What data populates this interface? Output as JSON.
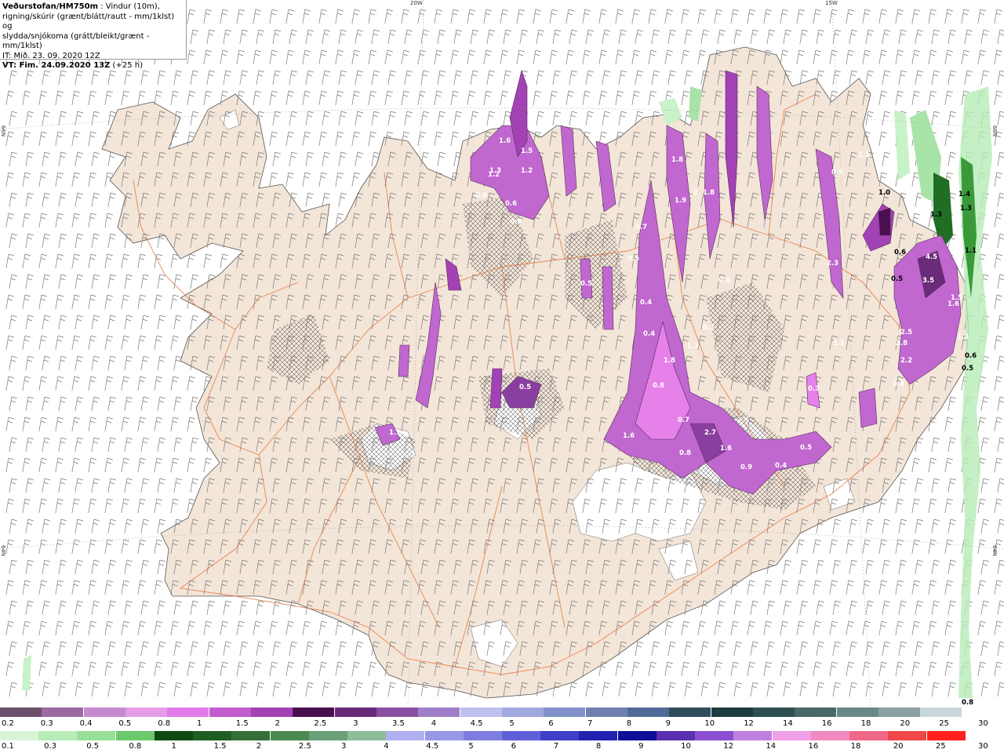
{
  "header": {
    "line1_bold": "Veðurstofan/HM750m",
    "line1_rest": " : Vindur (10m),",
    "line2": "rigning/skúrir (grænt/blátt/rautt - mm/1klst) og",
    "line3": "slydda/snjókoma (grátt/bleikt/grænt - mm/1klst)",
    "line4": "IT: Mið. 23. 09. 2020 12Z",
    "line5_bold": "VT: Fim. 24.09.2020 13Z",
    "line5_rest": " (+25 h)"
  },
  "grid_labels": {
    "lon_20w": "20W",
    "lon_15w": "15W",
    "lat_66n_left": "66N",
    "lat_66n_right": "66N",
    "lat_64n_left": "64N",
    "lat_64n_right": "64N"
  },
  "colors": {
    "land": "#f3e5d8",
    "sea": "#ffffff",
    "roads": "#e8743a",
    "coast": "#555555",
    "snow": "#9b59b6",
    "rain": "#5cd68a"
  },
  "map_labels": [
    {
      "id": "l1",
      "text": "1.6"
    },
    {
      "id": "l2",
      "text": "1.3"
    },
    {
      "id": "l3",
      "text": "1.2"
    },
    {
      "id": "l4",
      "text": "0.6"
    },
    {
      "id": "l5",
      "text": "1.5"
    },
    {
      "id": "l6",
      "text": "0.6"
    },
    {
      "id": "l7",
      "text": "1.2"
    },
    {
      "id": "l8",
      "text": "0.6"
    },
    {
      "id": "l9",
      "text": "1.8"
    },
    {
      "id": "l10",
      "text": "1.9"
    },
    {
      "id": "l11",
      "text": "2"
    },
    {
      "id": "l12",
      "text": "1.8"
    },
    {
      "id": "l13",
      "text": "0.7"
    },
    {
      "id": "l14",
      "text": "0.5"
    },
    {
      "id": "l15",
      "text": "0.4"
    },
    {
      "id": "l16",
      "text": "0.4"
    },
    {
      "id": "l17",
      "text": "1.8"
    },
    {
      "id": "l18",
      "text": "1.3"
    },
    {
      "id": "l19",
      "text": "0.7"
    },
    {
      "id": "l20",
      "text": "0.8"
    },
    {
      "id": "l21",
      "text": "0.7"
    },
    {
      "id": "l22",
      "text": "2.7"
    },
    {
      "id": "l23",
      "text": "1.6"
    },
    {
      "id": "l24",
      "text": "0.8"
    },
    {
      "id": "l25",
      "text": "1.6"
    },
    {
      "id": "l26",
      "text": "0.9"
    },
    {
      "id": "l27",
      "text": "0.4"
    },
    {
      "id": "l28",
      "text": "0.5"
    },
    {
      "id": "l29",
      "text": "0.5"
    },
    {
      "id": "l30",
      "text": "1.1"
    },
    {
      "id": "l31",
      "text": "0.5"
    },
    {
      "id": "l32",
      "text": "0.4"
    },
    {
      "id": "l33",
      "text": "1.5"
    },
    {
      "id": "l34",
      "text": "2.5"
    },
    {
      "id": "l35",
      "text": "2.8"
    },
    {
      "id": "l36",
      "text": "2.2"
    },
    {
      "id": "l37",
      "text": "3.5"
    },
    {
      "id": "l38",
      "text": "4.5"
    },
    {
      "id": "l39",
      "text": "1.6"
    },
    {
      "id": "l40",
      "text": "1.3"
    },
    {
      "id": "l41",
      "text": "0.8"
    },
    {
      "id": "l42",
      "text": "1.0"
    },
    {
      "id": "l43",
      "text": "1.4"
    },
    {
      "id": "l44",
      "text": "1.3"
    },
    {
      "id": "l45",
      "text": "1.3"
    },
    {
      "id": "l46",
      "text": "1.1"
    },
    {
      "id": "l47",
      "text": "0.5"
    },
    {
      "id": "l48",
      "text": "0.8"
    },
    {
      "id": "l49",
      "text": "0.6"
    },
    {
      "id": "l50",
      "text": "0.9"
    },
    {
      "id": "l51",
      "text": "2.3"
    },
    {
      "id": "l52",
      "text": "1.1"
    },
    {
      "id": "l53",
      "text": "0.5"
    },
    {
      "id": "l54",
      "text": "0.6"
    },
    {
      "id": "l55",
      "text": "1.2"
    },
    {
      "id": "l56",
      "text": "0.3"
    }
  ],
  "legend": {
    "snow_colors": [
      "#6b4f6b",
      "#9a6aa0",
      "#c68ad0",
      "#e59de8",
      "#e07ae8",
      "#c35ccf",
      "#a242b5",
      "#4a0f4f",
      "#6a2b7a",
      "#8a4fa0",
      "#a07fc8",
      "#c0c0f0",
      "#a0a8e0",
      "#8090c8",
      "#6f80b0",
      "#506a98",
      "#2f4c5c",
      "#1c3c40",
      "#2f5050",
      "#4a6868",
      "#6a8888",
      "#8aa0a0",
      "#c8d8d8"
    ],
    "snow_labels": [
      "0.2",
      "0.3",
      "0.4",
      "0.5",
      "0.8",
      "1",
      "1.5",
      "2",
      "2.5",
      "3",
      "3.5",
      "4",
      "4.5",
      "5",
      "6",
      "7",
      "8",
      "9",
      "10",
      "12",
      "14",
      "16",
      "18",
      "20",
      "25",
      "30"
    ],
    "rain_colors": [
      "#d8f5d8",
      "#b8ecb8",
      "#98e098",
      "#6cc86c",
      "#0f4a12",
      "#1f5e22",
      "#336f36",
      "#4a8a50",
      "#6aa078",
      "#8cbc98",
      "#b0b0f0",
      "#9898e8",
      "#7e7ee0",
      "#5f5fd8",
      "#3f3fc8",
      "#2222b0",
      "#0f0f98",
      "#5a30b0",
      "#8a50d0",
      "#c080e0",
      "#f0a0e8",
      "#f08ac0",
      "#f06888",
      "#f04848",
      "#ff2020"
    ],
    "rain_labels": [
      "0.1",
      "0.3",
      "0.5",
      "0.8",
      "1",
      "1.5",
      "2",
      "2.5",
      "3",
      "4",
      "4.5",
      "5",
      "6",
      "7",
      "8",
      "9",
      "10",
      "12",
      "14",
      "16",
      "18",
      "20",
      "25",
      "30"
    ],
    "corner_value": "0.8"
  }
}
